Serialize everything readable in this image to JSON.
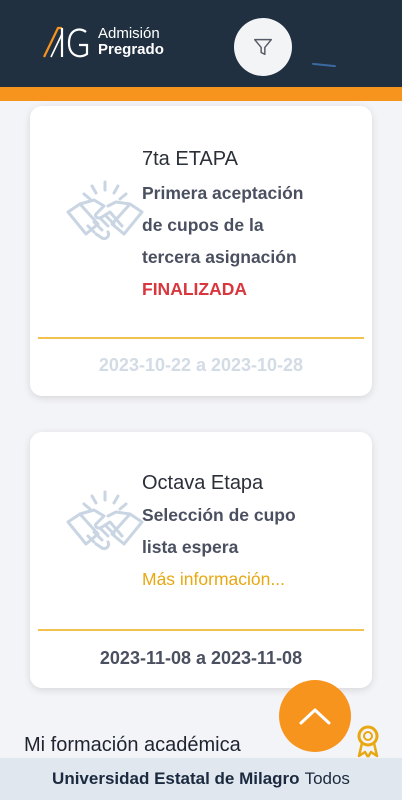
{
  "header": {
    "logo_line1": "Admisión",
    "logo_line2": "Pregrado",
    "filter_icon": "filter-icon"
  },
  "cards": [
    {
      "title": "7ta ETAPA",
      "description_lines": [
        "Primera aceptación",
        "de cupos de la",
        "tercera asignación"
      ],
      "status": "FINALIZADA",
      "dates": "2023-10-22 a 2023-10-28",
      "icon": "handshake-icon"
    },
    {
      "title": "Octava Etapa",
      "description_lines": [
        "Selección de cupo",
        "lista espera"
      ],
      "more_info": "Más información...",
      "dates": "2023-11-08 a 2023-11-08",
      "icon": "handshake-icon"
    }
  ],
  "section": {
    "title": "Mi formación académica",
    "icon": "award-icon"
  },
  "fab": {
    "icon": "chevron-up-icon"
  },
  "footer": {
    "university": "Universidad Estatal de Milagro",
    "suffix": "Todos"
  },
  "colors": {
    "header_bg": "#203040",
    "accent_orange": "#f7941d",
    "status_red": "#d9363e",
    "link_yellow": "#e8a812"
  }
}
